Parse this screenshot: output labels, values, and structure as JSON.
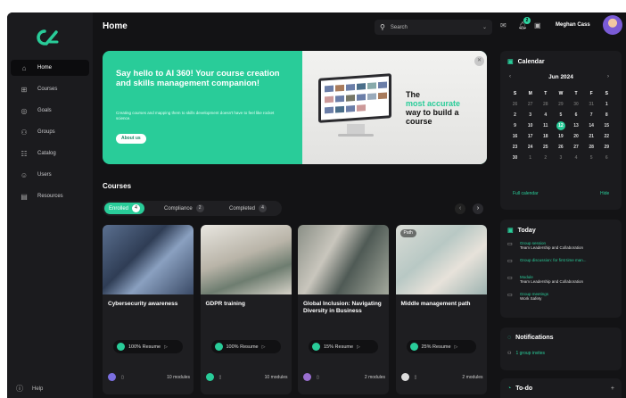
{
  "app": {
    "title": "Home"
  },
  "sidebar": {
    "items": [
      {
        "label": "Home",
        "icon": "home-icon",
        "glyph": "⌂",
        "active": true
      },
      {
        "label": "Courses",
        "icon": "courses-icon",
        "glyph": "⊞"
      },
      {
        "label": "Goals",
        "icon": "goals-icon",
        "glyph": "◎"
      },
      {
        "label": "Groups",
        "icon": "groups-icon",
        "glyph": "⚇"
      },
      {
        "label": "Catalog",
        "icon": "catalog-icon",
        "glyph": "☷"
      },
      {
        "label": "Users",
        "icon": "users-icon",
        "glyph": "☺"
      },
      {
        "label": "Resources",
        "icon": "resources-icon",
        "glyph": "▤"
      }
    ],
    "help_label": "Help"
  },
  "header": {
    "search_placeholder": "Search",
    "user_name": "Meghan Cass",
    "notification_count": "2"
  },
  "hero": {
    "title": "Say hello to AI 360! Your course creation and skills management companion!",
    "description": "Creating courses and mapping them to skills development doesn't have to feel like rocket science.",
    "button_label": "About us",
    "tagline_1": "The",
    "tagline_2": "most accurate",
    "tagline_3": "way to build a course"
  },
  "courses": {
    "title": "Courses",
    "tabs": [
      {
        "label": "Enrolled",
        "count": "4",
        "active": true
      },
      {
        "label": "Compliance",
        "count": "2"
      },
      {
        "label": "Completed",
        "count": "4"
      }
    ],
    "cards": [
      {
        "title": "Cybersecurity awareness",
        "progress": "100%",
        "action": "Resume",
        "modules": "10 modules",
        "chip": ""
      },
      {
        "title": "GDPR training",
        "progress": "100%",
        "action": "Resume",
        "modules": "10 modules",
        "chip": ""
      },
      {
        "title": "Global Inclusion: Navigating Diversity in Business",
        "progress": "15%",
        "action": "Resume",
        "modules": "2 modules",
        "chip": ""
      },
      {
        "title": "Middle management path",
        "progress": "25%",
        "action": "Resume",
        "modules": "2 modules",
        "chip": "Path"
      }
    ]
  },
  "calendar": {
    "title": "Calendar",
    "month": "Jun 2024",
    "weekdays": [
      "S",
      "M",
      "T",
      "W",
      "T",
      "F",
      "S"
    ],
    "weeks": [
      [
        "26",
        "27",
        "28",
        "29",
        "30",
        "31",
        "1"
      ],
      [
        "2",
        "3",
        "4",
        "5",
        "6",
        "7",
        "8"
      ],
      [
        "9",
        "10",
        "11",
        "12",
        "13",
        "14",
        "15"
      ],
      [
        "16",
        "17",
        "18",
        "19",
        "20",
        "21",
        "22"
      ],
      [
        "23",
        "24",
        "25",
        "26",
        "27",
        "28",
        "29"
      ],
      [
        "30",
        "1",
        "2",
        "3",
        "4",
        "5",
        "6"
      ]
    ],
    "selected_day": "12",
    "full_calendar_label": "Full calendar",
    "hide_label": "Hide"
  },
  "today": {
    "title": "Today",
    "items": [
      {
        "type": "Group session",
        "detail": "Team Leadership and Collaboration"
      },
      {
        "type": "Group discussion: for first time man...",
        "detail": ""
      },
      {
        "type": "Module",
        "detail": "Team Leadership and Collaboration"
      },
      {
        "type": "Group meetings",
        "detail": "Work Safety"
      }
    ]
  },
  "notifications": {
    "title": "Notifications",
    "item": "1 group invites"
  },
  "todo": {
    "title": "To-do"
  },
  "colors": {
    "accent": "#29cc99",
    "background": "#131315",
    "panel": "#1b1b1e"
  }
}
